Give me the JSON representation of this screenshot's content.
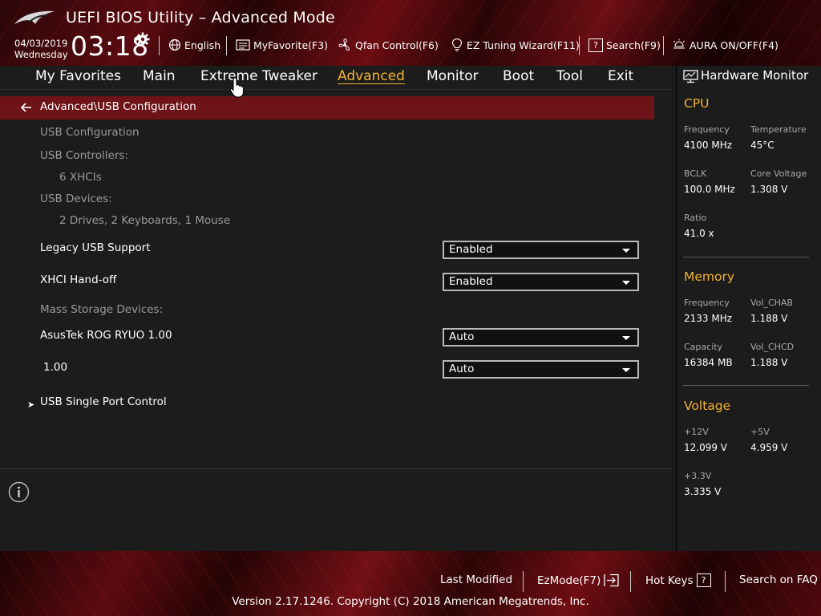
{
  "header": {
    "title": "UEFI BIOS Utility – Advanced Mode",
    "date": "04/03/2019",
    "weekday": "Wednesday",
    "time": "03:18",
    "toolbar": {
      "language": "English",
      "myfavorite": "MyFavorite(F3)",
      "qfan": "Qfan Control(F6)",
      "ez_tuning": "EZ Tuning Wizard(F11)",
      "search": "Search(F9)",
      "aura": "AURA ON/OFF(F4)"
    }
  },
  "tabs": {
    "favorites": "My Favorites",
    "main": "Main",
    "extreme": "Extreme Tweaker",
    "advanced": "Advanced",
    "monitor": "Monitor",
    "boot": "Boot",
    "tool": "Tool",
    "exit": "Exit"
  },
  "content": {
    "breadcrumb": "Advanced\\USB Configuration",
    "usb_configuration": "USB Configuration",
    "usb_controllers_label": "USB Controllers:",
    "usb_controllers_value": "6 XHCIs",
    "usb_devices_label": "USB Devices:",
    "usb_devices_value": "2 Drives, 2 Keyboards, 1 Mouse",
    "legacy_usb_label": "Legacy USB Support",
    "legacy_usb_value": "Enabled",
    "xhci_label": "XHCI Hand-off",
    "xhci_value": "Enabled",
    "mass_storage_label": "Mass Storage Devices:",
    "device1_label": "AsusTek ROG RYUO 1.00",
    "device1_value": "Auto",
    "device2_label": "1.00",
    "device2_value": "Auto",
    "submenu_label": "USB Single Port Control"
  },
  "hardware_monitor": {
    "title": "Hardware Monitor",
    "cpu": {
      "heading": "CPU",
      "frequency_label": "Frequency",
      "frequency": "4100 MHz",
      "temperature_label": "Temperature",
      "temperature": "45°C",
      "bclk_label": "BCLK",
      "bclk": "100.0 MHz",
      "core_voltage_label": "Core Voltage",
      "core_voltage": "1.308 V",
      "ratio_label": "Ratio",
      "ratio": "41.0 x"
    },
    "memory": {
      "heading": "Memory",
      "frequency_label": "Frequency",
      "frequency": "2133 MHz",
      "vol_chab_label": "Vol_CHAB",
      "vol_chab": "1.188 V",
      "capacity_label": "Capacity",
      "capacity": "16384 MB",
      "vol_chcd_label": "Vol_CHCD",
      "vol_chcd": "1.188 V"
    },
    "voltage": {
      "heading": "Voltage",
      "v12_label": "+12V",
      "v12": "12.099 V",
      "v5_label": "+5V",
      "v5": "4.959 V",
      "v33_label": "+3.3V",
      "v33": "3.335 V"
    }
  },
  "footer": {
    "last_modified": "Last Modified",
    "ezmode": "EzMode(F7)",
    "hot_keys": "Hot Keys",
    "hot_keys_box": "?",
    "search_faq": "Search on FAQ",
    "copyright": "Version 2.17.1246. Copyright (C) 2018 American Megatrends, Inc."
  },
  "colors": {
    "accent": "#f2b233",
    "breadcrumb_bg": "#6e1318",
    "panel_bg": "#1c1c1c"
  }
}
